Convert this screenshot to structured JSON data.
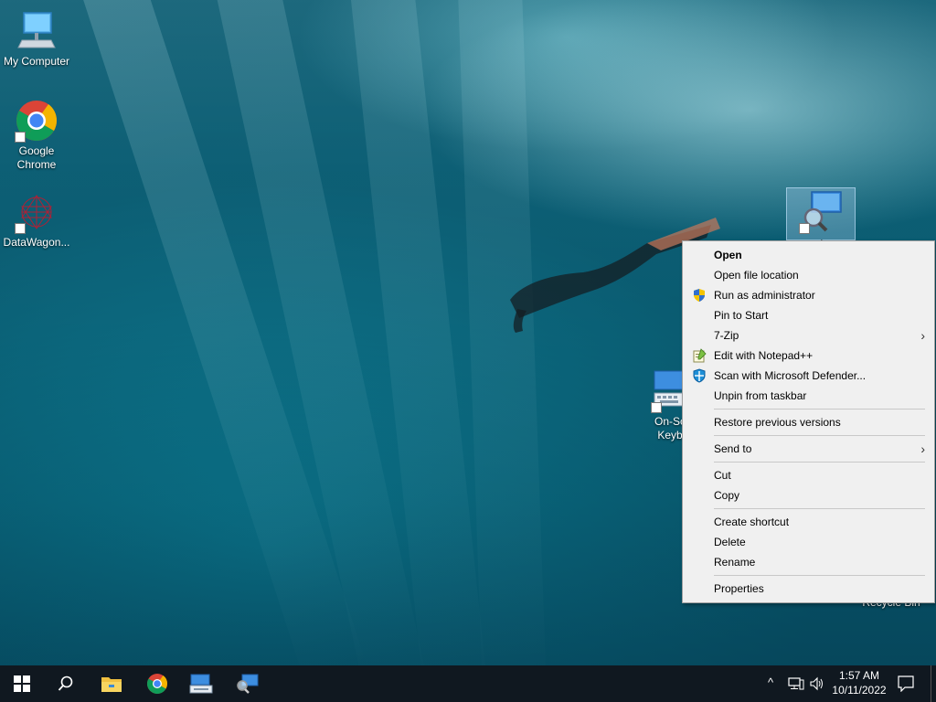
{
  "desktop": {
    "icons": [
      {
        "label": "My Computer"
      },
      {
        "label": "Google Chrome"
      },
      {
        "label": "DataWagon..."
      },
      {
        "label": "On-Screen Keyboard"
      },
      {
        "label": "Recycle Bin"
      }
    ]
  },
  "context_menu": {
    "items": [
      {
        "label": "Open",
        "bold": true
      },
      {
        "label": "Open file location"
      },
      {
        "label": "Run as administrator",
        "icon": "uac-shield-icon"
      },
      {
        "label": "Pin to Start"
      },
      {
        "label": "7-Zip",
        "submenu": true
      },
      {
        "label": "Edit with Notepad++",
        "icon": "notepad-plus-plus-icon"
      },
      {
        "label": "Scan with Microsoft Defender...",
        "icon": "defender-shield-icon"
      },
      {
        "label": "Unpin from taskbar"
      },
      {
        "label": "Restore previous versions"
      },
      {
        "label": "Send to",
        "submenu": true
      },
      {
        "label": "Cut"
      },
      {
        "label": "Copy"
      },
      {
        "label": "Create shortcut"
      },
      {
        "label": "Delete"
      },
      {
        "label": "Rename"
      },
      {
        "label": "Properties"
      }
    ],
    "submenu_arrow": "›"
  },
  "taskbar": {
    "clock_time": "1:57 AM",
    "clock_date": "10/11/2022",
    "tray_chevron": "^"
  },
  "colors": {
    "taskbar_bg": "#101820",
    "menu_bg": "#f0f0f0",
    "accent_blue": "#1e90d8"
  }
}
